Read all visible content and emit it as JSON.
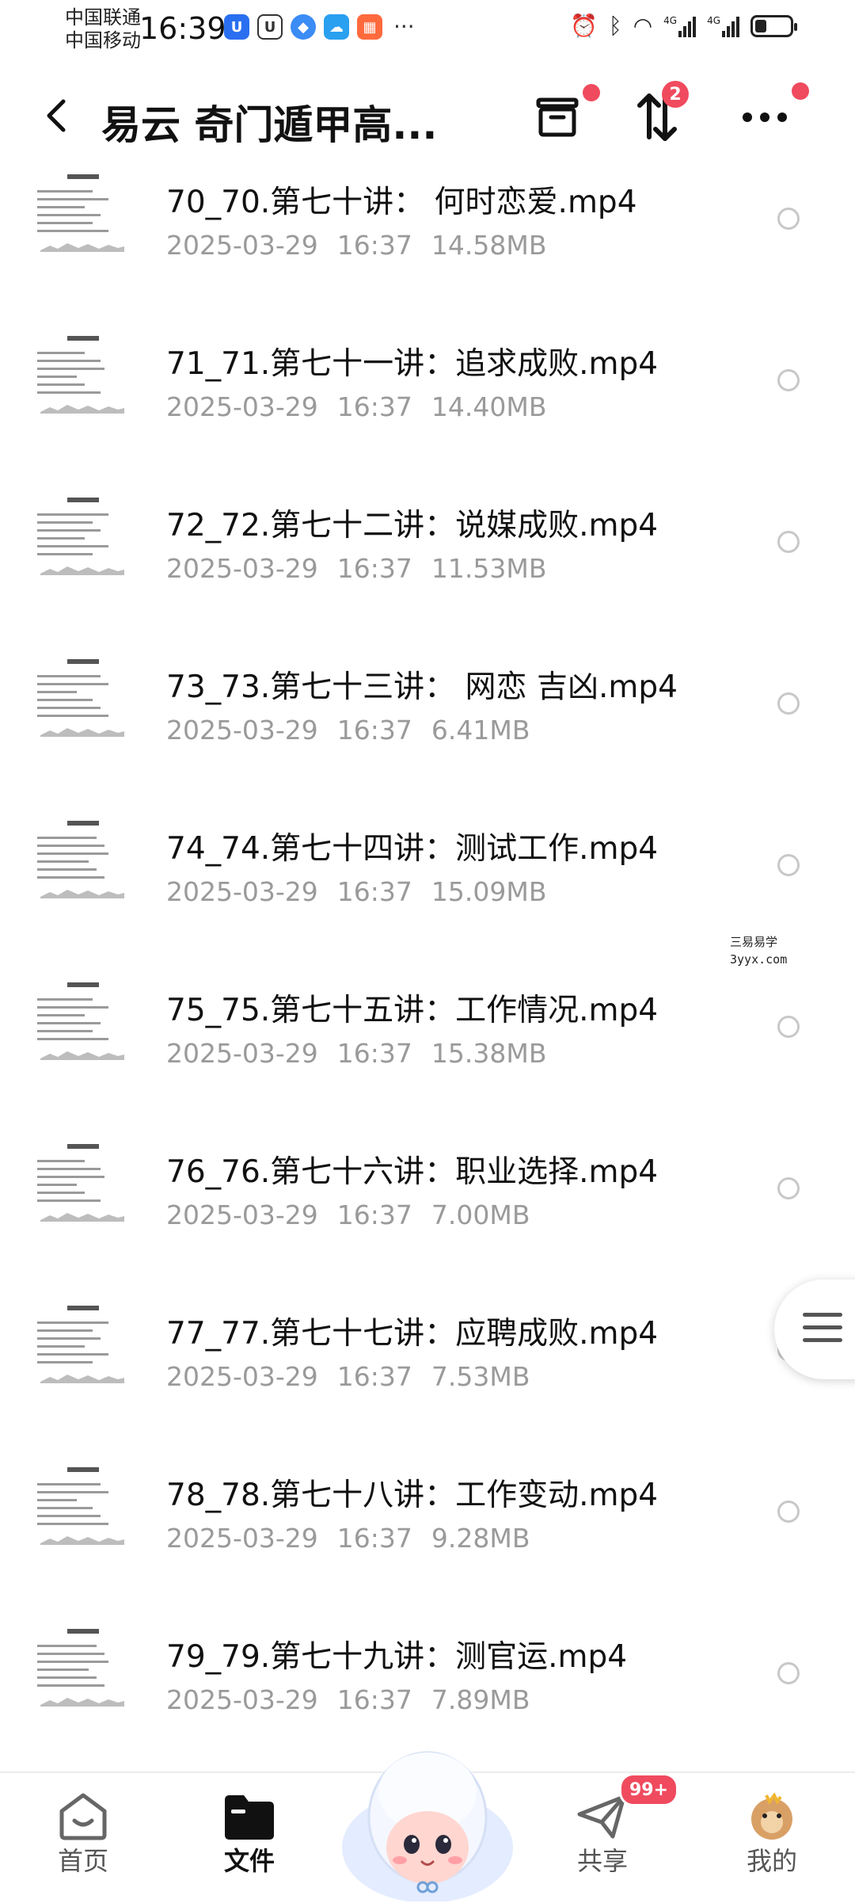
{
  "status_bar": {
    "carrier_1": "中国联通",
    "carrier_2": "中国移动",
    "time": "16:39",
    "more": "···",
    "signal_1_label": "4G",
    "signal_2_label": "4G"
  },
  "header": {
    "title": "易云 奇门遁甲高...",
    "transfer_badge": "2"
  },
  "files": [
    {
      "name": "70_70.第七十讲： 何时恋爱.mp4",
      "date": "2025-03-29",
      "time": "16:37",
      "size": "14.58MB"
    },
    {
      "name": "71_71.第七十一讲：追求成败.mp4",
      "date": "2025-03-29",
      "time": "16:37",
      "size": "14.40MB"
    },
    {
      "name": "72_72.第七十二讲：说媒成败.mp4",
      "date": "2025-03-29",
      "time": "16:37",
      "size": "11.53MB"
    },
    {
      "name": "73_73.第七十三讲： 网恋 吉凶.mp4",
      "date": "2025-03-29",
      "time": "16:37",
      "size": "6.41MB"
    },
    {
      "name": "74_74.第七十四讲：测试工作.mp4",
      "date": "2025-03-29",
      "time": "16:37",
      "size": "15.09MB"
    },
    {
      "name": "75_75.第七十五讲：工作情况.mp4",
      "date": "2025-03-29",
      "time": "16:37",
      "size": "15.38MB"
    },
    {
      "name": "76_76.第七十六讲：职业选择.mp4",
      "date": "2025-03-29",
      "time": "16:37",
      "size": "7.00MB"
    },
    {
      "name": "77_77.第七十七讲：应聘成败.mp4",
      "date": "2025-03-29",
      "time": "16:37",
      "size": "7.53MB"
    },
    {
      "name": "78_78.第七十八讲：工作变动.mp4",
      "date": "2025-03-29",
      "time": "16:37",
      "size": "9.28MB"
    },
    {
      "name": "79_79.第七十九讲：测官运.mp4",
      "date": "2025-03-29",
      "time": "16:37",
      "size": "7.89MB"
    }
  ],
  "watermark": {
    "line1": "三易易学",
    "line2": "3yyx.com"
  },
  "bottom_nav": {
    "home": "首页",
    "files": "文件",
    "share": "共享",
    "share_badge": "99+",
    "mine": "我的"
  },
  "colors": {
    "accent_red": "#f04a5e",
    "meta_gray": "#9a9a9a"
  }
}
